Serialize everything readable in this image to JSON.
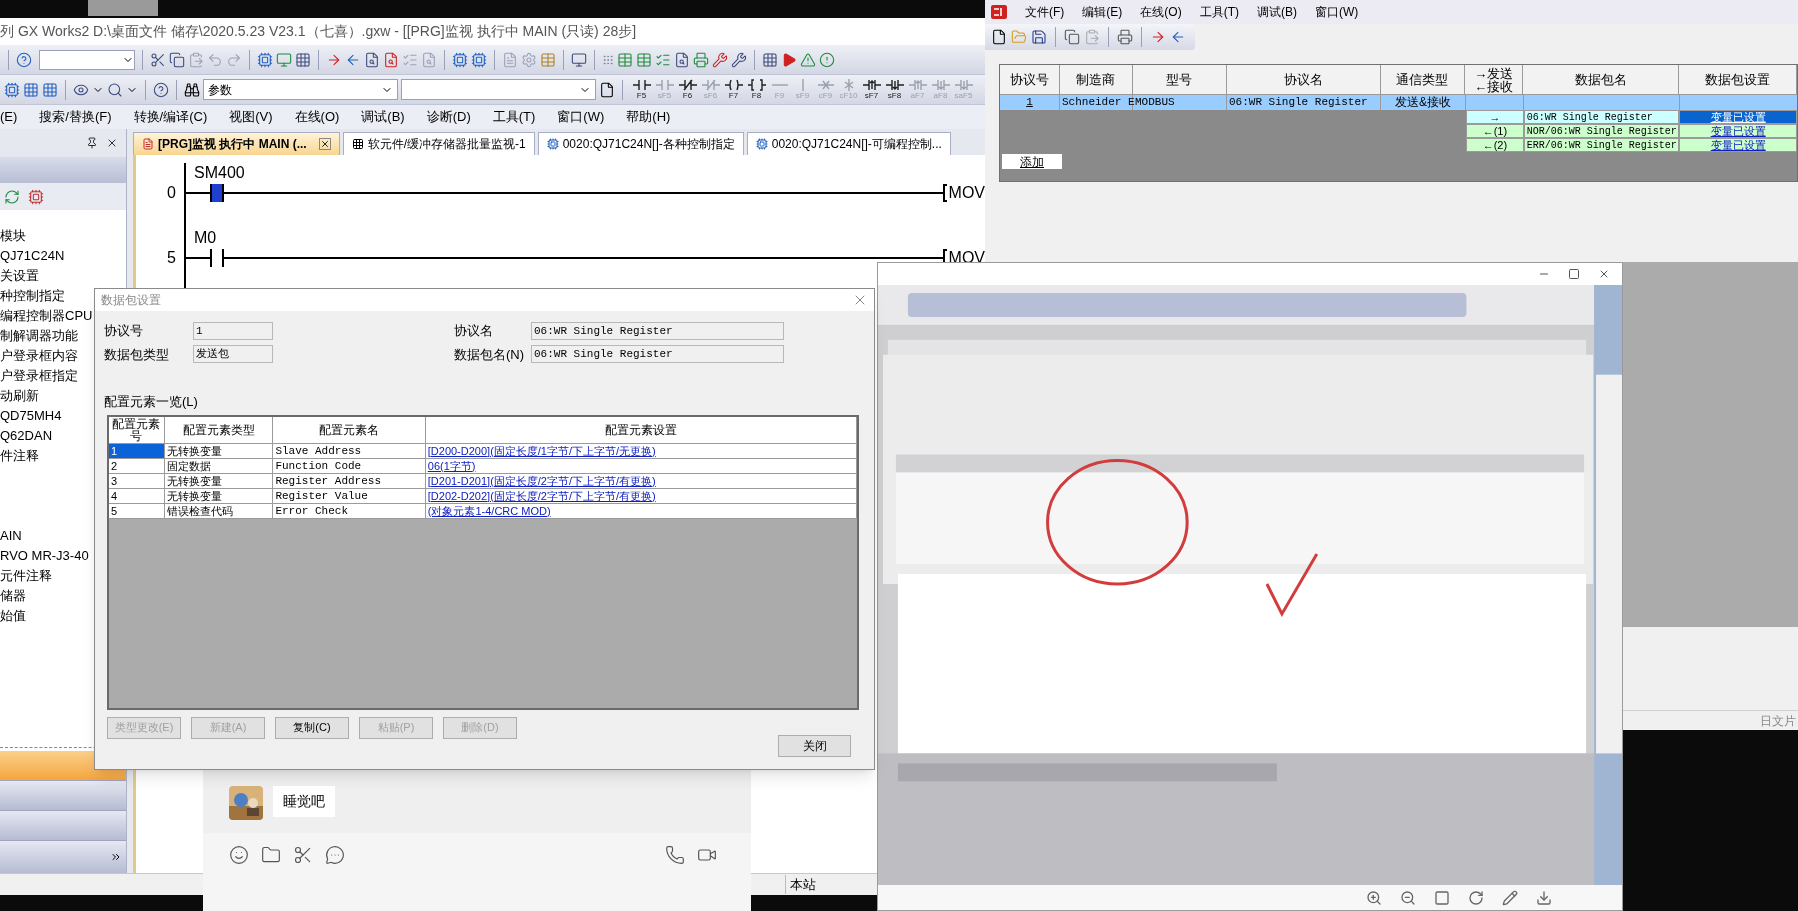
{
  "gx_window": {
    "title": "列 GX Works2 D:\\桌面文件 储存\\2020.5.23 V23.1（七喜）.gxw - [[PRG]监视 执行中 MAIN (只读) 28步]",
    "search_box": {
      "value": "参数"
    },
    "ladder_keys": [
      {
        "label": "F5",
        "kind": "contact",
        "disabled": false
      },
      {
        "label": "sF5",
        "kind": "contact",
        "disabled": true
      },
      {
        "label": "F6",
        "kind": "contact_nc",
        "disabled": false
      },
      {
        "label": "sF6",
        "kind": "contact_nc",
        "disabled": true
      },
      {
        "label": "F7",
        "kind": "coil",
        "disabled": false
      },
      {
        "label": "F8",
        "kind": "instruction",
        "disabled": false
      },
      {
        "label": "F9",
        "kind": "hline",
        "disabled": true
      },
      {
        "label": "sF9",
        "kind": "vline",
        "disabled": true
      },
      {
        "label": "cF9",
        "kind": "delete_h",
        "disabled": true
      },
      {
        "label": "cF10",
        "kind": "delete_v",
        "disabled": true
      },
      {
        "label": "sF7",
        "kind": "pulse",
        "disabled": false
      },
      {
        "label": "sF8",
        "kind": "pulse_down",
        "disabled": false
      },
      {
        "label": "aF7",
        "kind": "pulse",
        "disabled": true
      },
      {
        "label": "aF8",
        "kind": "pulse_down",
        "disabled": true
      },
      {
        "label": "saF5",
        "kind": "pulse_down",
        "disabled": true
      }
    ],
    "menu": [
      "(E)",
      "搜索/替换(F)",
      "转换/编译(C)",
      "视图(V)",
      "在线(O)",
      "调试(B)",
      "诊断(D)",
      "工具(T)",
      "窗口(W)",
      "帮助(H)"
    ],
    "navigation": {
      "sections": [
        {
          "items": [
            "模块",
            "QJ71C24N",
            "关设置",
            "种控制指定",
            "编程控制器CPU",
            "制解调器功能",
            "户登录框内容",
            "户登录框指定",
            "动刷新",
            "QD75MH4",
            "Q62DAN",
            "件注释"
          ]
        },
        {
          "items": [
            "AIN",
            "RVO  MR-J3-40",
            "元件注释",
            "储器",
            "始值"
          ]
        }
      ]
    },
    "tabs": [
      {
        "label": "[PRG]监视 执行中 MAIN (...",
        "selected": true,
        "kind": "ladder"
      },
      {
        "label": "软元件/缓冲存储器批量监视-1",
        "selected": false,
        "kind": "monitor"
      },
      {
        "label": "0020:QJ71C24N[]-各种控制指定",
        "selected": false,
        "kind": "module"
      },
      {
        "label": "0020:QJ71C24N[]-可编程控制...",
        "selected": false,
        "kind": "module"
      }
    ],
    "ladder": {
      "rungs": [
        {
          "step": "0",
          "contact": "SM400",
          "on": true,
          "instruction": "MOV"
        },
        {
          "step": "5",
          "contact": "M0",
          "on": false,
          "instruction": "MOV"
        }
      ]
    },
    "status_bar": {
      "station": "本站"
    }
  },
  "dialog": {
    "title": "数据包设置",
    "fields": [
      {
        "label": "协议号",
        "value": "1"
      },
      {
        "label": "协议名",
        "value": "06:WR Single Register"
      },
      {
        "label": "数据包类型",
        "value": "发送包"
      },
      {
        "label": "数据包名(N)",
        "value": "06:WR Single Register"
      }
    ],
    "list_label": "配置元素一览(L)",
    "table": {
      "columns": [
        "配置元素号",
        "配置元素类型",
        "配置元素名",
        "配置元素设置"
      ],
      "rows": [
        {
          "cells": [
            "1",
            "无转换变量",
            "Slave Address",
            "[D200-D200](固定长度/1字节/下上字节/无更换)"
          ],
          "selected": true
        },
        {
          "cells": [
            "2",
            "固定数据",
            "Function Code",
            "06(1字节)"
          ],
          "selected": false
        },
        {
          "cells": [
            "3",
            "无转换变量",
            "Register Address",
            "[D201-D201](固定长度/2字节/下上字节/有更换)"
          ],
          "selected": false
        },
        {
          "cells": [
            "4",
            "无转换变量",
            "Register Value",
            "[D202-D202](固定长度/2字节/下上字节/有更换)"
          ],
          "selected": false
        },
        {
          "cells": [
            "5",
            "错误检查代码",
            "Error Check",
            "(对象元素1-4/CRC MOD)"
          ],
          "selected": false
        }
      ]
    },
    "buttons": [
      {
        "label": "类型更改(E)",
        "disabled": true
      },
      {
        "label": "新建(A)",
        "disabled": true
      },
      {
        "label": "复制(C)",
        "disabled": false
      },
      {
        "label": "粘贴(P)",
        "disabled": true
      },
      {
        "label": "删除(D)",
        "disabled": true
      }
    ],
    "close_button": "关闭"
  },
  "protocol_window": {
    "menu": [
      "文件(F)",
      "编辑(E)",
      "在线(O)",
      "工具(T)",
      "调试(B)",
      "窗口(W)"
    ],
    "columns": [
      {
        "lines": [
          "协议号"
        ]
      },
      {
        "lines": [
          "制造商"
        ]
      },
      {
        "lines": [
          "型号"
        ]
      },
      {
        "lines": [
          "协议名"
        ]
      },
      {
        "lines": [
          "通信类型"
        ]
      },
      {
        "lines": [
          "→发送",
          "←接收"
        ]
      },
      {
        "lines": [
          "数据包名"
        ]
      },
      {
        "lines": [
          "数据包设置"
        ]
      }
    ],
    "protocols": [
      {
        "cells": [
          "1",
          "Schneider E",
          "MODBUS",
          "06:WR Single Register",
          "发送&接收"
        ],
        "selected": true
      }
    ],
    "packets": [
      {
        "direction": "→",
        "name": "06:WR Single Register",
        "setting": "变量已设置",
        "kind": "send",
        "selected": true
      },
      {
        "direction": "←(1)",
        "name": "NOR/06:WR Single Register",
        "setting": "变量已设置",
        "kind": "receive",
        "selected": false
      },
      {
        "direction": "←(2)",
        "name": "ERR/06:WR Single Register",
        "setting": "变量已设置",
        "kind": "receive",
        "selected": false
      }
    ],
    "add_button": "添加"
  },
  "chat": {
    "message": "睡觉吧"
  },
  "side_panel": {
    "text": "日文片"
  }
}
